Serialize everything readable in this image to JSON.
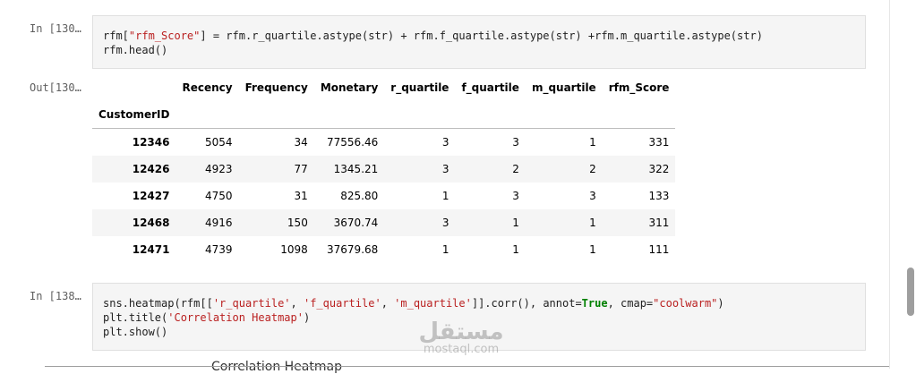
{
  "cells": [
    {
      "in_prompt": "In [130…",
      "code_lines": [
        [
          {
            "t": "rfm[",
            "c": ""
          },
          {
            "t": "\"rfm_Score\"",
            "c": "str"
          },
          {
            "t": "] = rfm.r_quartile.astype(str) + rfm.f_quartile.astype(str) +rfm.m_quartile.astype(str)",
            "c": ""
          }
        ],
        [
          {
            "t": "rfm.head()",
            "c": ""
          }
        ]
      ],
      "out_prompt": "Out[130…",
      "table": {
        "columns": [
          "Recency",
          "Frequency",
          "Monetary",
          "r_quartile",
          "f_quartile",
          "m_quartile",
          "rfm_Score"
        ],
        "index_name": "CustomerID",
        "rows": [
          {
            "id": "12346",
            "values": [
              "5054",
              "34",
              "77556.46",
              "3",
              "3",
              "1",
              "331"
            ]
          },
          {
            "id": "12426",
            "values": [
              "4923",
              "77",
              "1345.21",
              "3",
              "2",
              "2",
              "322"
            ]
          },
          {
            "id": "12427",
            "values": [
              "4750",
              "31",
              "825.80",
              "1",
              "3",
              "3",
              "133"
            ]
          },
          {
            "id": "12468",
            "values": [
              "4916",
              "150",
              "3670.74",
              "3",
              "1",
              "1",
              "311"
            ]
          },
          {
            "id": "12471",
            "values": [
              "4739",
              "1098",
              "37679.68",
              "1",
              "1",
              "1",
              "111"
            ]
          }
        ]
      }
    },
    {
      "in_prompt": "In [138…",
      "code_lines": [
        [
          {
            "t": "sns.heatmap(rfm[[",
            "c": ""
          },
          {
            "t": "'r_quartile'",
            "c": "str"
          },
          {
            "t": ", ",
            "c": ""
          },
          {
            "t": "'f_quartile'",
            "c": "str"
          },
          {
            "t": ", ",
            "c": ""
          },
          {
            "t": "'m_quartile'",
            "c": "str"
          },
          {
            "t": "]].corr(), annot=",
            "c": ""
          },
          {
            "t": "True",
            "c": "kw"
          },
          {
            "t": ", cmap=",
            "c": ""
          },
          {
            "t": "\"coolwarm\"",
            "c": "str"
          },
          {
            "t": ")",
            "c": ""
          }
        ],
        [
          {
            "t": "plt.title(",
            "c": ""
          },
          {
            "t": "'Correlation Heatmap'",
            "c": "str"
          },
          {
            "t": ")",
            "c": ""
          }
        ],
        [
          {
            "t": "plt.show()",
            "c": ""
          }
        ]
      ]
    }
  ],
  "partial_output_text": "Correlation Heatmap",
  "watermark": {
    "arabic": "مستقل",
    "latin": "mostaql.com"
  },
  "colors": {
    "string": "#ba2121",
    "keyword": "#008000",
    "cell_bg": "#f5f5f5",
    "prompt": "#5f5f5f"
  }
}
